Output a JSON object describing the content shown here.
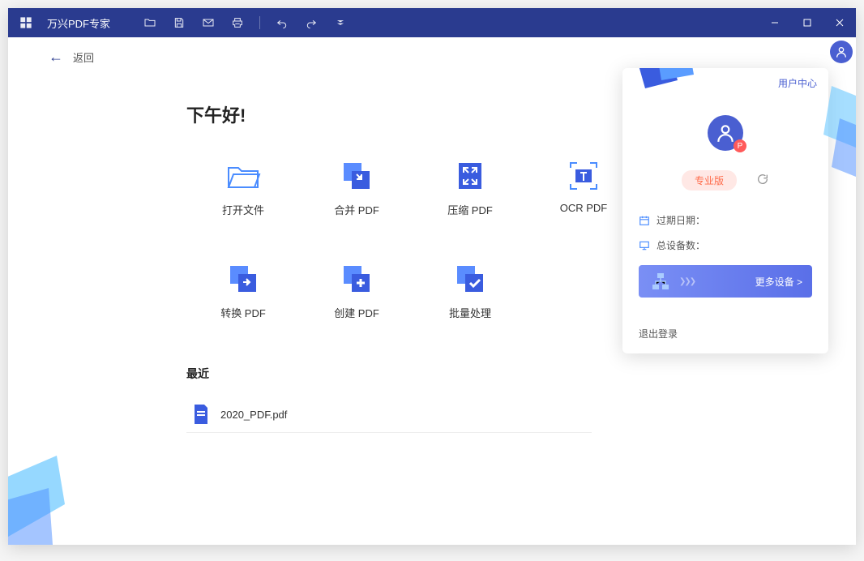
{
  "app": {
    "title": "万兴PDF专家"
  },
  "nav": {
    "back_label": "返回"
  },
  "greeting": "下午好!",
  "actions": [
    {
      "id": "open",
      "label": "打开文件"
    },
    {
      "id": "merge",
      "label": "合并 PDF"
    },
    {
      "id": "compress",
      "label": "压缩 PDF"
    },
    {
      "id": "ocr",
      "label": "OCR PDF"
    },
    {
      "id": "convert",
      "label": "转换 PDF"
    },
    {
      "id": "create",
      "label": "创建 PDF"
    },
    {
      "id": "batch",
      "label": "批量处理"
    }
  ],
  "recent": {
    "title": "最近",
    "files": [
      {
        "name": "2020_PDF.pdf"
      }
    ]
  },
  "user_panel": {
    "user_center": "用户中心",
    "pro_label": "专业版",
    "expire_label": "过期日期：",
    "expire_value": "",
    "devices_label": "总设备数：",
    "devices_value": "",
    "more_devices": "更多设备 >",
    "logout": "退出登录",
    "badge_letter": "P"
  }
}
